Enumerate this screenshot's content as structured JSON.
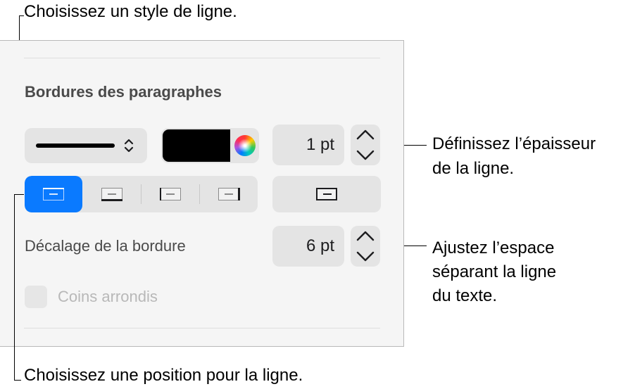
{
  "callouts": {
    "line_style": "Choisissez un style de ligne.",
    "thickness_line1": "Définissez l’épaisseur",
    "thickness_line2": "de la ligne.",
    "offset_line1": "Ajustez l’espace",
    "offset_line2": "séparant la ligne",
    "offset_line3": "du texte.",
    "position": "Choisissez une position pour la ligne."
  },
  "panel": {
    "section_title": "Bordures des paragraphes",
    "line_style": {
      "selected": "solid",
      "icon": "chevron-updown-icon"
    },
    "color": {
      "value": "#000000",
      "icon": "color-wheel-icon"
    },
    "thickness": {
      "value": "1 pt",
      "icon": "stepper-icon"
    },
    "positions": {
      "items": [
        "top",
        "bottom",
        "left",
        "right"
      ],
      "selected": "top"
    },
    "full_border": {
      "icon": "full-border-icon"
    },
    "offset": {
      "label": "Décalage de la bordure",
      "value": "6 pt"
    },
    "rounded": {
      "label": "Coins arrondis",
      "checked": false,
      "enabled": false
    }
  },
  "colors": {
    "accent": "#0a7aff",
    "panel_bg": "#f5f5f5",
    "control_bg": "#e4e4e4"
  }
}
